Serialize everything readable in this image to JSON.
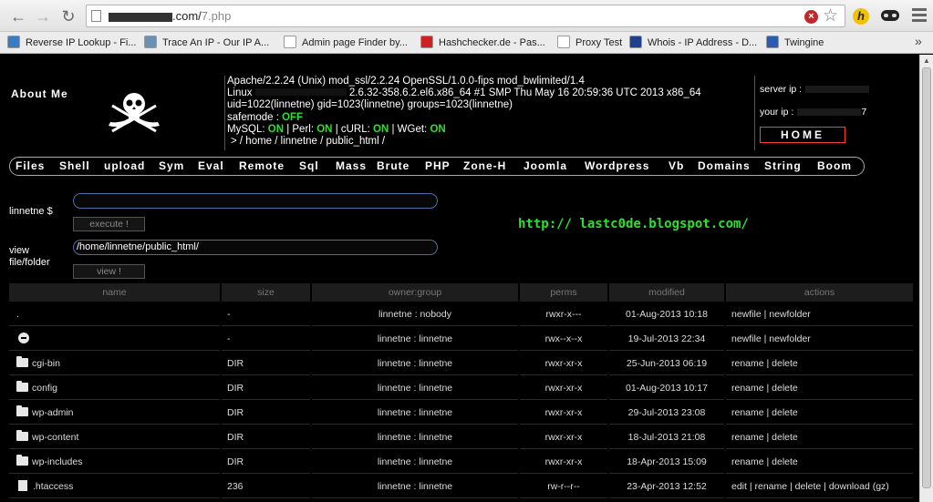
{
  "browser": {
    "url_visible": ".com/",
    "url_file": "7.php",
    "bookmarks": [
      {
        "label": "Reverse IP Lookup - Fi...",
        "color": "#3b7bbf"
      },
      {
        "label": "Trace An IP - Our IP A...",
        "color": "#6b8fb5"
      },
      {
        "label": "Admin page Finder by...",
        "color": "#ffffff"
      },
      {
        "label": "Hashchecker.de - Pas...",
        "color": "#cc2222"
      },
      {
        "label": "Proxy Test",
        "color": "#ffffff"
      },
      {
        "label": "Whois - IP Address - D...",
        "color": "#1f3f8f"
      },
      {
        "label": "Twingine",
        "color": "#2a5db0"
      }
    ],
    "bookmarks_more": "»"
  },
  "header": {
    "about": "About Me",
    "server_line": "Apache/2.2.24 (Unix) mod_ssl/2.2.24 OpenSSL/1.0.0-fips mod_bwlimited/1.4",
    "linux_prefix": "Linux",
    "linux_suffix": "2.6.32-358.6.2.el6.x86_64 #1 SMP Thu May 16 20:59:36 UTC 2013 x86_64",
    "uid_line": "uid=1022(linnetne) gid=1023(linnetne) groups=1023(linnetne)",
    "safemode_label": "safemode :",
    "safemode_value": "OFF",
    "mysql_label": "MySQL:",
    "mysql_value": "ON",
    "perl_label": "| Perl:",
    "perl_value": "ON",
    "curl_label": "| cURL:",
    "curl_value": "ON",
    "wget_label": "| WGet:",
    "wget_value": "ON",
    "path_line": ">  / home / linnetne / public_html /",
    "server_ip_label": "server ip :",
    "your_ip_label": "your ip :",
    "your_ip_tail": "7",
    "home_label": "HOME"
  },
  "menu": [
    "Files",
    "Shell",
    "upload",
    "Sym",
    "Eval",
    "Remote",
    "Sql",
    "Mass",
    "Brute",
    "PHP",
    "Zone-H",
    "Joomla",
    "Wordpress",
    "Vb",
    "Domains",
    "String",
    "Boom"
  ],
  "command": {
    "label": "linnetne $",
    "value": "",
    "execute_label": "execute !"
  },
  "link_text": "http:// lastc0de.blogspot.com/",
  "viewer": {
    "label_line1": "view",
    "label_line2": "file/folder",
    "path_value": "/home/linnetne/public_html/",
    "view_label": "view !"
  },
  "table": {
    "headers": [
      "name",
      "size",
      "owner:group",
      "perms",
      "modified",
      "actions"
    ],
    "rows": [
      {
        "icon": "none",
        "name": ".",
        "size": "-",
        "owner": "linnetne : nobody",
        "perms": "rwxr-x---",
        "modified": "01-Aug-2013 10:18",
        "actions": "newfile | newfolder"
      },
      {
        "icon": "back",
        "name": "",
        "size": "-",
        "owner": "linnetne : linnetne",
        "perms": "rwx--x--x",
        "modified": "19-Jul-2013 22:34",
        "actions": "newfile | newfolder"
      },
      {
        "icon": "folder",
        "name": "cgi-bin",
        "size": "DIR",
        "owner": "linnetne : linnetne",
        "perms": "rwxr-xr-x",
        "modified": "25-Jun-2013 06:19",
        "actions": "rename | delete"
      },
      {
        "icon": "folder",
        "name": "config",
        "size": "DIR",
        "owner": "linnetne : linnetne",
        "perms": "rwxr-xr-x",
        "modified": "01-Aug-2013 10:17",
        "actions": "rename | delete"
      },
      {
        "icon": "folder",
        "name": "wp-admin",
        "size": "DIR",
        "owner": "linnetne : linnetne",
        "perms": "rwxr-xr-x",
        "modified": "29-Jul-2013 23:08",
        "actions": "rename | delete"
      },
      {
        "icon": "folder",
        "name": "wp-content",
        "size": "DIR",
        "owner": "linnetne : linnetne",
        "perms": "rwxr-xr-x",
        "modified": "18-Jul-2013 21:08",
        "actions": "rename | delete"
      },
      {
        "icon": "folder",
        "name": "wp-includes",
        "size": "DIR",
        "owner": "linnetne : linnetne",
        "perms": "rwxr-xr-x",
        "modified": "18-Apr-2013 15:09",
        "actions": "rename | delete"
      },
      {
        "icon": "file",
        "name": ".htaccess",
        "size": "236",
        "owner": "linnetne : linnetne",
        "perms": "rw-r--r--",
        "modified": "23-Apr-2013 12:52",
        "actions": "edit | rename | delete | download (gz)"
      }
    ]
  },
  "colors": {
    "on": "#2ee02e",
    "home_border": "#ff3b2f",
    "input_border": "#4a6fa5"
  }
}
